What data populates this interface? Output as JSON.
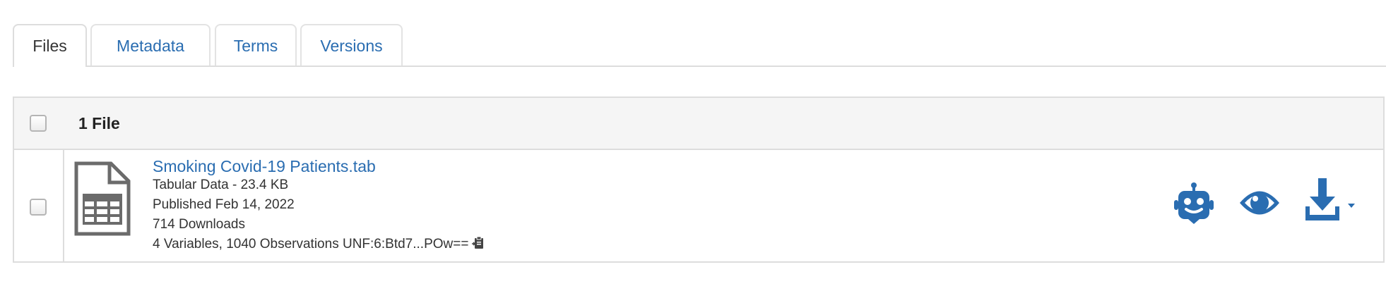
{
  "tabs": [
    {
      "label": "Files",
      "active": true
    },
    {
      "label": "Metadata",
      "active": false
    },
    {
      "label": "Terms",
      "active": false
    },
    {
      "label": "Versions",
      "active": false
    }
  ],
  "files_table": {
    "header": {
      "count_label": "1 File"
    },
    "rows": [
      {
        "file_name": "Smoking Covid-19 Patients.tab",
        "type_size": "Tabular Data - 23.4 KB",
        "published": "Published Feb 14, 2022",
        "downloads": "714 Downloads",
        "variables_unf": "4 Variables, 1040 Observations UNF:6:Btd7...POw==",
        "file_icon": "tabular-file-icon",
        "actions": [
          "robot-icon",
          "eye-icon",
          "download-icon"
        ]
      }
    ]
  },
  "colors": {
    "link": "#2a6db1",
    "text": "#333333",
    "header_bg": "#f5f5f5",
    "border": "#dddddd"
  }
}
